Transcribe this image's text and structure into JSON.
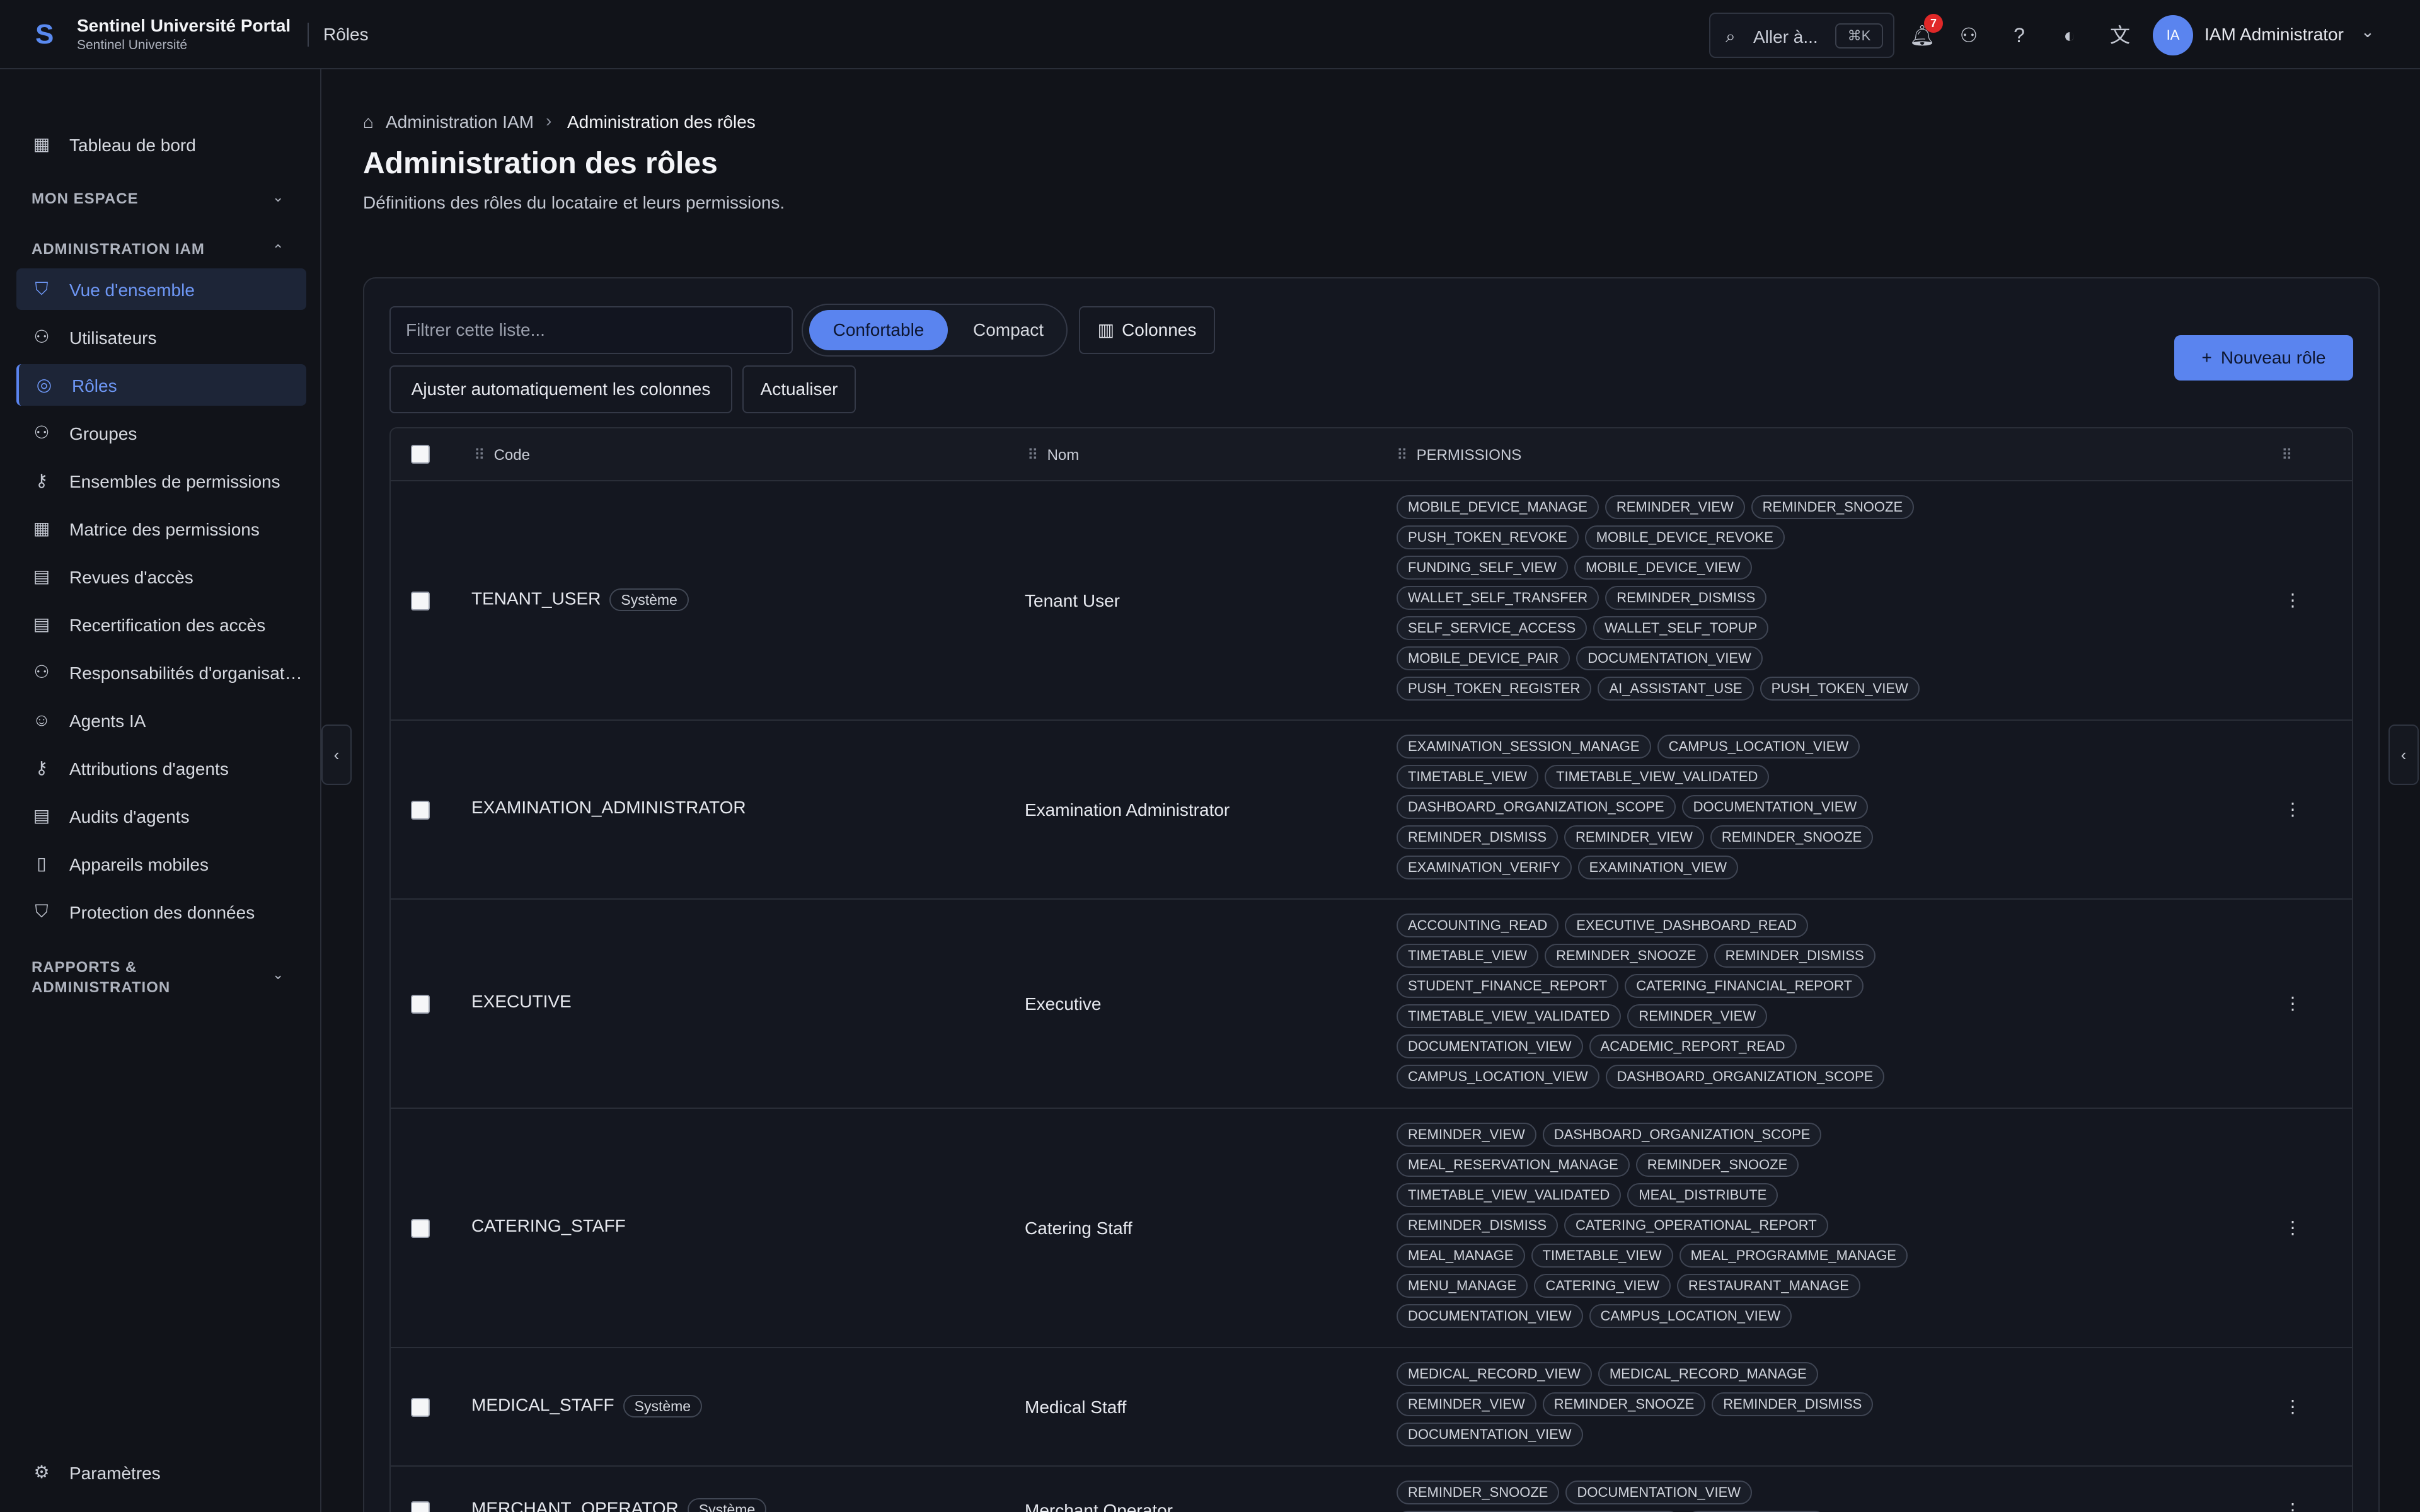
{
  "header": {
    "brand": "Sentinel Université Portal",
    "tenant": "Sentinel Université",
    "crumb": "Rôles",
    "search": "Aller à...",
    "shortcut": "⌘K",
    "notif_count": "7",
    "avatar_initials": "IA",
    "user": "IAM Administrator"
  },
  "sidebar": {
    "dashboard": "Tableau de bord",
    "sec_workspace": "MON ESPACE",
    "sec_iam": "ADMINISTRATION IAM",
    "items": [
      "Vue d'ensemble",
      "Utilisateurs",
      "Rôles",
      "Groupes",
      "Ensembles de permissions",
      "Matrice des permissions",
      "Revues d'accès",
      "Recertification des accès",
      "Responsabilités d'organisation",
      "Agents IA",
      "Attributions d'agents",
      "Audits d'agents",
      "Appareils mobiles",
      "Protection des données"
    ],
    "sec_reports_1": "RAPPORTS &",
    "sec_reports_2": "ADMINISTRATION",
    "settings": "Paramètres"
  },
  "breadcrumb": {
    "parent": "Administration IAM",
    "current": "Administration des rôles"
  },
  "page": {
    "title": "Administration des rôles",
    "subtitle": "Définitions des rôles du locataire et leurs permissions."
  },
  "toolbar": {
    "filter_placeholder": "Filtrer cette liste...",
    "density_comfortable": "Confortable",
    "density_compact": "Compact",
    "columns": "Colonnes",
    "autofit": "Ajuster automatiquement les colonnes",
    "refresh": "Actualiser",
    "new_role": "Nouveau rôle"
  },
  "table": {
    "headers": {
      "code": "Code",
      "name": "Nom",
      "permissions": "PERMISSIONS"
    },
    "system_label": "Système",
    "rows": [
      {
        "code": "TENANT_USER",
        "system": true,
        "name": "Tenant User",
        "perm_lines": [
          [
            "MOBILE_DEVICE_MANAGE",
            "REMINDER_VIEW",
            "REMINDER_SNOOZE"
          ],
          [
            "PUSH_TOKEN_REVOKE",
            "MOBILE_DEVICE_REVOKE"
          ],
          [
            "FUNDING_SELF_VIEW",
            "MOBILE_DEVICE_VIEW"
          ],
          [
            "WALLET_SELF_TRANSFER",
            "REMINDER_DISMISS"
          ],
          [
            "SELF_SERVICE_ACCESS",
            "WALLET_SELF_TOPUP"
          ],
          [
            "MOBILE_DEVICE_PAIR",
            "DOCUMENTATION_VIEW"
          ],
          [
            "PUSH_TOKEN_REGISTER",
            "AI_ASSISTANT_USE",
            "PUSH_TOKEN_VIEW"
          ]
        ]
      },
      {
        "code": "EXAMINATION_ADMINISTRATOR",
        "system": false,
        "name": "Examination Administrator",
        "perm_lines": [
          [
            "EXAMINATION_SESSION_MANAGE",
            "CAMPUS_LOCATION_VIEW"
          ],
          [
            "TIMETABLE_VIEW",
            "TIMETABLE_VIEW_VALIDATED"
          ],
          [
            "DASHBOARD_ORGANIZATION_SCOPE",
            "DOCUMENTATION_VIEW"
          ],
          [
            "REMINDER_DISMISS",
            "REMINDER_VIEW",
            "REMINDER_SNOOZE"
          ],
          [
            "EXAMINATION_VERIFY",
            "EXAMINATION_VIEW"
          ]
        ]
      },
      {
        "code": "EXECUTIVE",
        "system": false,
        "name": "Executive",
        "perm_lines": [
          [
            "ACCOUNTING_READ",
            "EXECUTIVE_DASHBOARD_READ"
          ],
          [
            "TIMETABLE_VIEW",
            "REMINDER_SNOOZE",
            "REMINDER_DISMISS"
          ],
          [
            "STUDENT_FINANCE_REPORT",
            "CATERING_FINANCIAL_REPORT"
          ],
          [
            "TIMETABLE_VIEW_VALIDATED",
            "REMINDER_VIEW"
          ],
          [
            "DOCUMENTATION_VIEW",
            "ACADEMIC_REPORT_READ"
          ],
          [
            "CAMPUS_LOCATION_VIEW",
            "DASHBOARD_ORGANIZATION_SCOPE"
          ]
        ]
      },
      {
        "code": "CATERING_STAFF",
        "system": false,
        "name": "Catering Staff",
        "perm_lines": [
          [
            "REMINDER_VIEW",
            "DASHBOARD_ORGANIZATION_SCOPE"
          ],
          [
            "MEAL_RESERVATION_MANAGE",
            "REMINDER_SNOOZE"
          ],
          [
            "TIMETABLE_VIEW_VALIDATED",
            "MEAL_DISTRIBUTE"
          ],
          [
            "REMINDER_DISMISS",
            "CATERING_OPERATIONAL_REPORT"
          ],
          [
            "MEAL_MANAGE",
            "TIMETABLE_VIEW",
            "MEAL_PROGRAMME_MANAGE"
          ],
          [
            "MENU_MANAGE",
            "CATERING_VIEW",
            "RESTAURANT_MANAGE"
          ],
          [
            "DOCUMENTATION_VIEW",
            "CAMPUS_LOCATION_VIEW"
          ]
        ]
      },
      {
        "code": "MEDICAL_STAFF",
        "system": true,
        "name": "Medical Staff",
        "perm_lines": [
          [
            "MEDICAL_RECORD_VIEW",
            "MEDICAL_RECORD_MANAGE"
          ],
          [
            "REMINDER_VIEW",
            "REMINDER_SNOOZE",
            "REMINDER_DISMISS"
          ],
          [
            "DOCUMENTATION_VIEW"
          ]
        ]
      },
      {
        "code": "MERCHANT_OPERATOR",
        "system": true,
        "name": "Merchant Operator",
        "perm_lines": [
          [
            "REMINDER_SNOOZE",
            "DOCUMENTATION_VIEW"
          ],
          [
            "MERCHANT_TRANSACTION_PROCESS",
            "REMINDER_VIEW"
          ]
        ]
      }
    ]
  }
}
